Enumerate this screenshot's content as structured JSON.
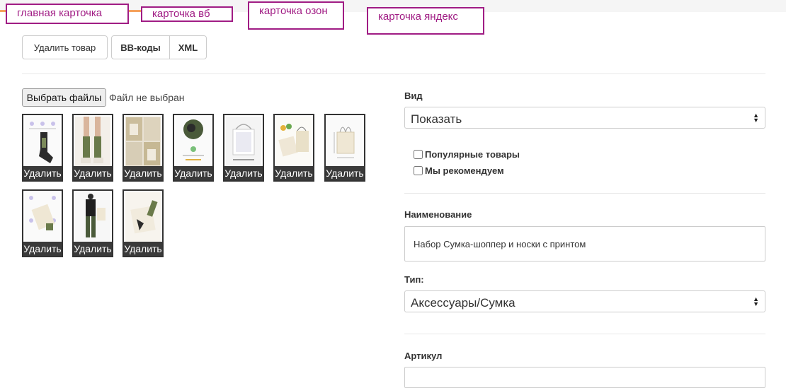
{
  "tabs": {
    "main": "главная карточка",
    "wb": "карточка вб",
    "ozon": "карточка озон",
    "yandex": "карточка яндекс"
  },
  "toolbar": {
    "delete_product": "Удалить товар",
    "bb_codes": "BB-коды",
    "xml": "XML"
  },
  "upload": {
    "choose_files": "Выбрать файлы",
    "status": "Файл не выбран"
  },
  "images": {
    "delete_label": "Удалить",
    "count": 10
  },
  "form": {
    "view_label": "Вид",
    "view_value": "Показать",
    "popular_label": "Популярные товары",
    "recommend_label": "Мы рекомендуем",
    "name_label": "Наименование",
    "name_value": "Набор Сумка-шоппер и носки с принтом",
    "type_label": "Тип:",
    "type_value": "Аксессуары/Сумка",
    "article_label": "Артикул"
  },
  "colors": {
    "tab_border": "#a01c84",
    "accent": "#f5a25d"
  }
}
